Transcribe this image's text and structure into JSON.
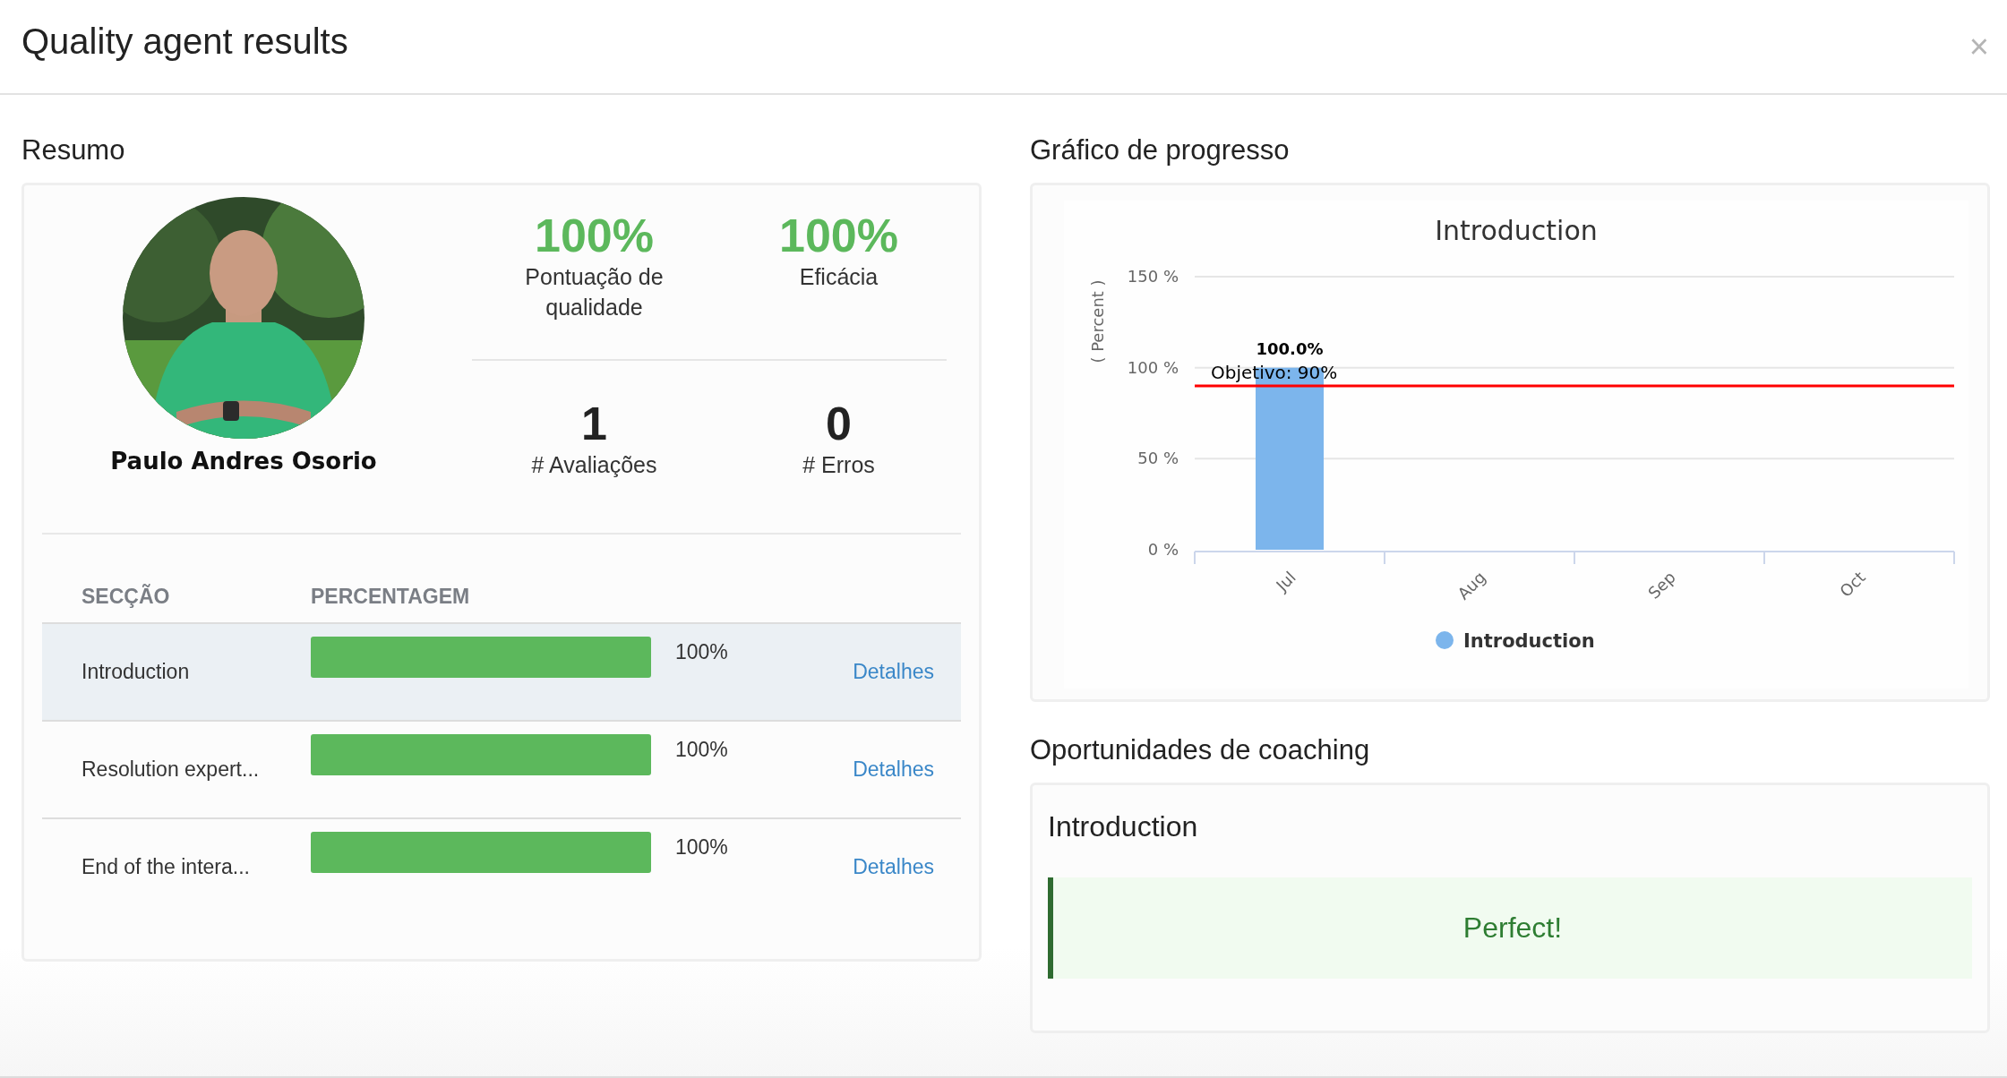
{
  "window": {
    "title": "Quality agent results",
    "close": "×"
  },
  "summary": {
    "heading": "Resumo",
    "agent": {
      "name": "Paulo Andres Osorio"
    },
    "stats": [
      {
        "kind": "percent",
        "value": "100%",
        "label": "Pontuação de qualidade"
      },
      {
        "kind": "percent",
        "value": "100%",
        "label": "Eficácia"
      },
      {
        "kind": "count",
        "value": "1",
        "label": "# Avaliações"
      },
      {
        "kind": "count",
        "value": "0",
        "label": "# Erros"
      }
    ],
    "table": {
      "columns": [
        "SECÇÃO",
        "PERCENTAGEM"
      ],
      "rows": [
        {
          "section": "Introduction",
          "level": 1,
          "reading": "100%",
          "link": "Detalhes",
          "selected": true
        },
        {
          "section": "Resolution expert...",
          "level": 1,
          "reading": "100%",
          "link": "Detalhes",
          "selected": false
        },
        {
          "section": "End of the intera...",
          "level": 1,
          "reading": "100%",
          "link": "Detalhes",
          "selected": false
        }
      ]
    }
  },
  "progress": {
    "heading": "Gráfico de progresso",
    "chart_data": {
      "type": "bar",
      "title": "Introduction",
      "ylabel": "( Percent )",
      "categories": [
        "Jul",
        "Aug",
        "Sep",
        "Oct"
      ],
      "series": [
        {
          "name": "Introduction",
          "color": "#7cb5ec",
          "values": [
            100,
            null,
            null,
            null
          ]
        }
      ],
      "ylim": [
        0,
        150
      ],
      "yticks": [
        {
          "value": 0,
          "label": "0 %"
        },
        {
          "value": 50,
          "label": "50 %"
        },
        {
          "value": 100,
          "label": "100 %"
        },
        {
          "value": 150,
          "label": "150 %"
        }
      ],
      "value_labels": [
        "100.0%",
        null,
        null,
        null
      ],
      "ref_lines": [
        {
          "axis": "y",
          "value": 90,
          "label": "Objetivo: 90%",
          "color": "#ff0000"
        }
      ]
    }
  },
  "coaching": {
    "heading": "Oportunidades de coaching",
    "items": [
      {
        "title": "Introduction",
        "message": "Perfect!"
      }
    ]
  }
}
